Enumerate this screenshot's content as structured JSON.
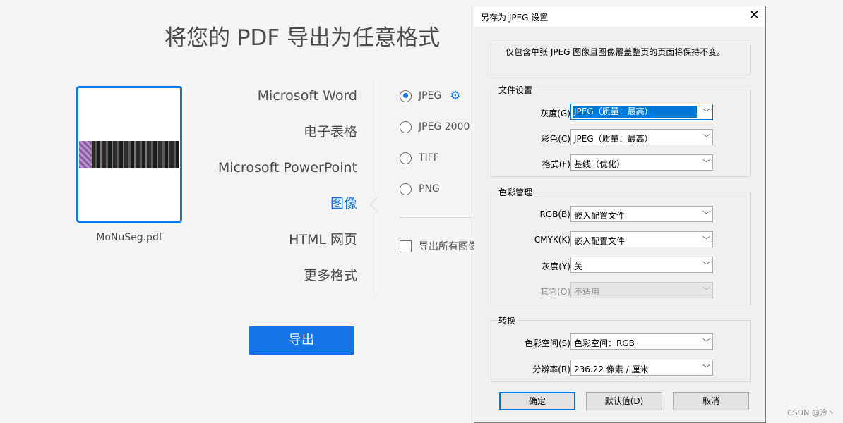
{
  "page": {
    "title": "将您的 PDF 导出为任意格式",
    "filename": "MoNuSeg.pdf",
    "formats": [
      "Microsoft Word",
      "电子表格",
      "Microsoft PowerPoint",
      "图像",
      "HTML 网页",
      "更多格式"
    ],
    "active_format": "图像",
    "image_options": [
      {
        "label": "JPEG",
        "checked": true
      },
      {
        "label": "JPEG 2000",
        "checked": false
      },
      {
        "label": "TIFF",
        "checked": false
      },
      {
        "label": "PNG",
        "checked": false
      }
    ],
    "export_all_label": "导出所有图像",
    "export_button": "导出",
    "accent_color": "#1473e6"
  },
  "dialog": {
    "title": "另存为 JPEG 设置",
    "close_glyph": "✕",
    "info": "仅包含单张 JPEG 图像且图像覆盖整页的页面将保持不变。",
    "file_settings": {
      "title": "文件设置",
      "fields": [
        {
          "label": "灰度(G):",
          "value": "JPEG（质量：最高）"
        },
        {
          "label": "彩色(C):",
          "value": "JPEG（质量：最高）"
        },
        {
          "label": "格式(F):",
          "value": "基线（优化）"
        }
      ]
    },
    "color_management": {
      "title": "色彩管理",
      "fields": [
        {
          "label": "RGB(B):",
          "value": "嵌入配置文件"
        },
        {
          "label": "CMYK(K):",
          "value": "嵌入配置文件"
        },
        {
          "label": "灰度(Y):",
          "value": "关"
        },
        {
          "label": "其它(O):",
          "value": "不适用"
        }
      ]
    },
    "conversion": {
      "title": "转换",
      "fields": [
        {
          "label": "色彩空间(S):",
          "value": "色彩空间：RGB"
        },
        {
          "label": "分辨率(R):",
          "value": "236.22 像素 / 厘米"
        }
      ]
    },
    "buttons": {
      "ok": "确定",
      "defaults": "默认值(D)",
      "cancel": "取消"
    }
  },
  "watermark": "CSDN @泠丶"
}
